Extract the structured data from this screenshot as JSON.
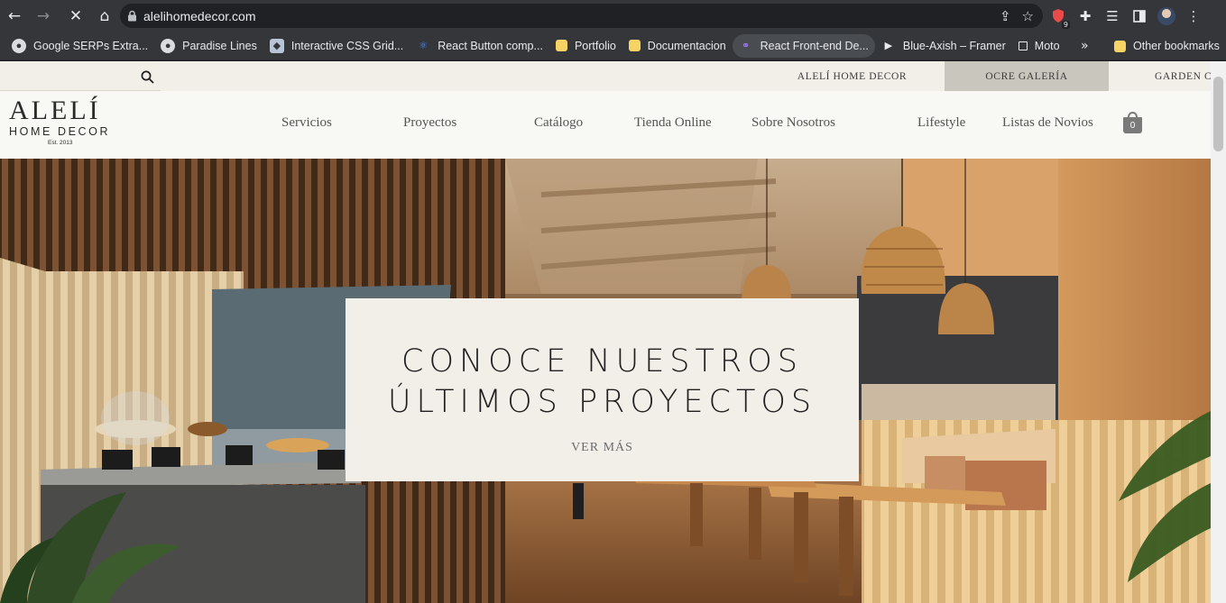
{
  "browser": {
    "url": "alelihomedecor.com",
    "extension_badge": "9",
    "bookmarks": [
      {
        "label": "Google SERPs Extra...",
        "icon": "globe-icon"
      },
      {
        "label": "Paradise Lines",
        "icon": "globe-icon"
      },
      {
        "label": "Interactive CSS Grid...",
        "icon": "cube-icon"
      },
      {
        "label": "React Button comp...",
        "icon": "react-icon"
      },
      {
        "label": "Portfolio",
        "icon": "folder-icon"
      },
      {
        "label": "Documentacion",
        "icon": "folder-icon"
      },
      {
        "label": "React Front-end De...",
        "icon": "link-icon"
      },
      {
        "label": "Blue-Axish – Framer",
        "icon": "framer-icon"
      },
      {
        "label": "Moto",
        "icon": "square-icon"
      }
    ],
    "other_bookmarks": "Other bookmarks"
  },
  "site": {
    "brand_tabs": [
      "ALELÍ HOME DECOR",
      "OCRE GALERÍA",
      "GARDEN CA"
    ],
    "logo": {
      "line1": "ALELÍ",
      "line2": "HOME DECOR",
      "line3": "Est. 2013"
    },
    "nav": [
      "Servicios",
      "Proyectos",
      "Catálogo",
      "Tienda Online",
      "Sobre Nosotros",
      "Lifestyle",
      "Listas de Novios"
    ],
    "cart_count": "0"
  },
  "hero": {
    "title_line1": "CONOCE NUESTROS",
    "title_line2": "ÚLTIMOS PROYECTOS",
    "link": "VER MÁS"
  },
  "colors": {
    "chrome_bg": "#35363a",
    "omnibox_bg": "#202124",
    "topbar_bg": "#f1efe8",
    "active_brand_tab": "#c9c6bd",
    "navbar_bg": "#f8f8f4"
  }
}
